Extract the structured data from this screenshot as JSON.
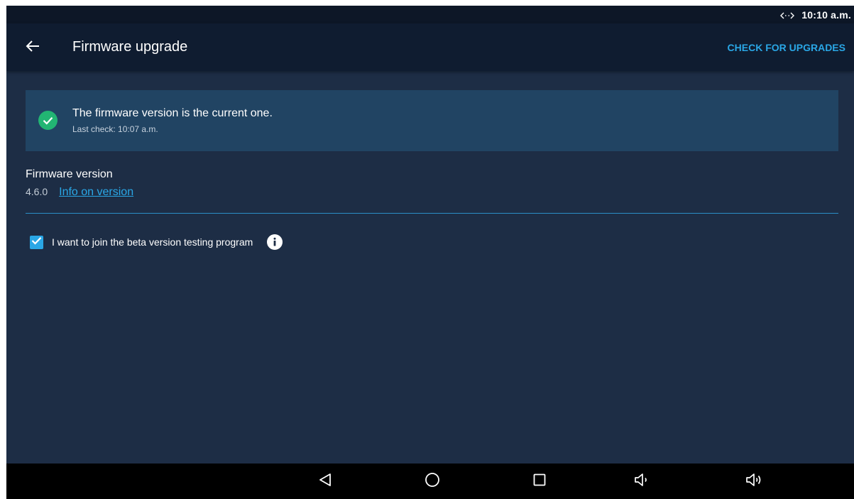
{
  "status_bar": {
    "time": "10:10 a.m.",
    "sync_icon": "sync-arrows-icon"
  },
  "app_bar": {
    "back_icon": "arrow-left-icon",
    "title": "Firmware upgrade",
    "action_label": "CHECK FOR UPGRADES"
  },
  "status_banner": {
    "icon": "check-circle-icon",
    "message": "The firmware version is the current one.",
    "last_check": "Last check: 10:07 a.m."
  },
  "firmware": {
    "label": "Firmware version",
    "version": "4.6.0",
    "info_link": "Info on version"
  },
  "beta_program": {
    "checked": true,
    "label": "I want to join the beta version testing program",
    "info_icon": "info-circle-icon"
  },
  "nav_bar": {
    "buttons": [
      "back-triangle-icon",
      "home-circle-icon",
      "recents-square-icon",
      "volume-down-icon",
      "volume-up-icon"
    ]
  },
  "colors": {
    "background": "#1d2d45",
    "app_bar": "#0f1c30",
    "banner": "#214463",
    "accent": "#2aa7e6",
    "success": "#22b573"
  }
}
